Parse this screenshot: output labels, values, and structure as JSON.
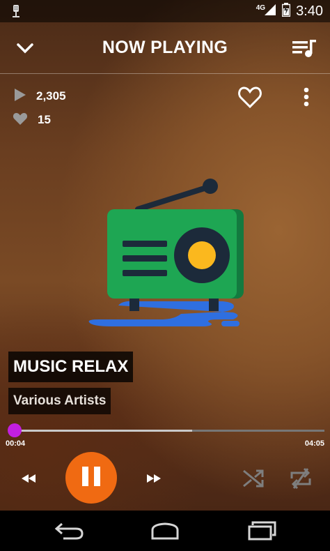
{
  "status_bar": {
    "time": "3:40",
    "network": "4G",
    "left_icon": "microphone-icon",
    "icons": [
      "signal-icon",
      "battery-icon"
    ]
  },
  "toolbar": {
    "title": "NOW PLAYING",
    "collapse_icon": "chevron-down-icon",
    "queue_icon": "queue-music-icon"
  },
  "stats": {
    "plays": "2,305",
    "likes": "15",
    "play_icon": "play-count-icon",
    "like_icon": "heart-filled-icon"
  },
  "actions": {
    "favorite_icon": "heart-outline-icon",
    "more_icon": "more-vert-icon"
  },
  "artwork": {
    "icon": "radio-icon"
  },
  "track": {
    "title": "MUSIC RELAX",
    "artist": "Various Artists"
  },
  "progress": {
    "elapsed": "00:04",
    "duration": "04:05",
    "played_fraction": 0.016,
    "buffered_fraction": 0.58
  },
  "controls": {
    "rewind_icon": "rewind-icon",
    "pause_icon": "pause-icon",
    "forward_icon": "fast-forward-icon",
    "shuffle_icon": "shuffle-icon",
    "repeat_icon": "repeat-icon"
  },
  "nav_bar": {
    "back_icon": "back-icon",
    "home_icon": "home-icon",
    "recents_icon": "recents-icon"
  },
  "colors": {
    "accent": "#f06a12",
    "seek_thumb": "#c21fe0",
    "background": "#6a3e20"
  }
}
